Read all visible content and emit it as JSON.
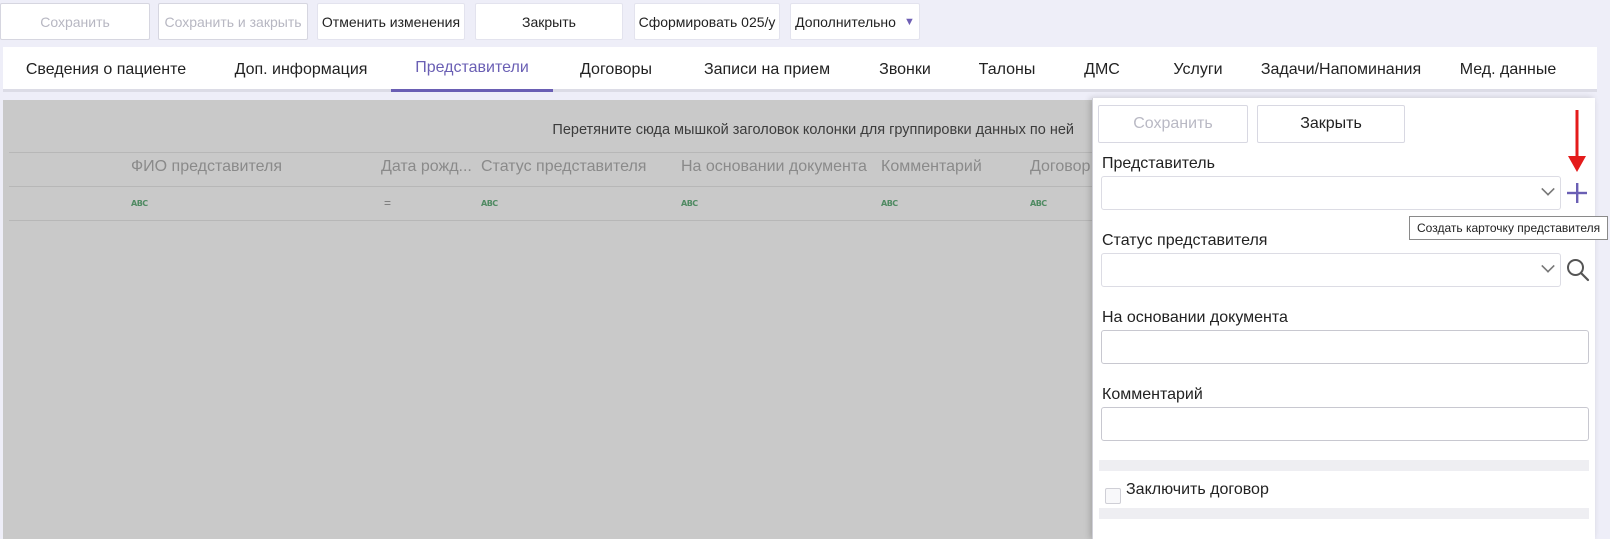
{
  "toolbar": {
    "save_label": "Сохранить",
    "save_close_label": "Сохранить и закрыть",
    "cancel_changes_label": "Отменить изменения",
    "close_label": "Закрыть",
    "form_025_label": "Сформировать 025/у",
    "more_label": "Дополнительно"
  },
  "tabs": [
    {
      "label": "Сведения о пациенте"
    },
    {
      "label": "Доп. информация"
    },
    {
      "label": "Представители",
      "active": true
    },
    {
      "label": "Договоры"
    },
    {
      "label": "Записи на прием"
    },
    {
      "label": "Звонки"
    },
    {
      "label": "Талоны"
    },
    {
      "label": "ДМС"
    },
    {
      "label": "Услуги"
    },
    {
      "label": "Задачи/Напоминания"
    },
    {
      "label": "Мед. данные"
    }
  ],
  "grid": {
    "group_hint": "Перетяните сюда мышкой заголовок колонки для группировки данных по ней",
    "columns": [
      {
        "label": "ФИО представителя",
        "filter": "ABC"
      },
      {
        "label": "Дата рожд...",
        "filter": "="
      },
      {
        "label": "Статус представителя",
        "filter": "ABC"
      },
      {
        "label": "На основании документа",
        "filter": "ABC"
      },
      {
        "label": "Комментарий",
        "filter": "ABC"
      },
      {
        "label": "Договор",
        "filter": "ABC"
      }
    ]
  },
  "panel": {
    "save_label": "Сохранить",
    "close_label": "Закрыть",
    "representative_label": "Представитель",
    "representative_value": "",
    "status_label": "Статус представителя",
    "status_value": "",
    "document_label": "На основании документа",
    "document_value": "",
    "comment_label": "Комментарий",
    "comment_value": "",
    "contract_checkbox_label": "Заключить договор",
    "contract_checked": false
  },
  "tooltip": {
    "text": "Создать карточку представителя"
  },
  "colors": {
    "accent": "#6a5fb4",
    "arrow": "#e41b1b"
  },
  "icons": {
    "add": "plus-icon",
    "search": "search-icon",
    "dropdown": "chevron-down-icon"
  }
}
